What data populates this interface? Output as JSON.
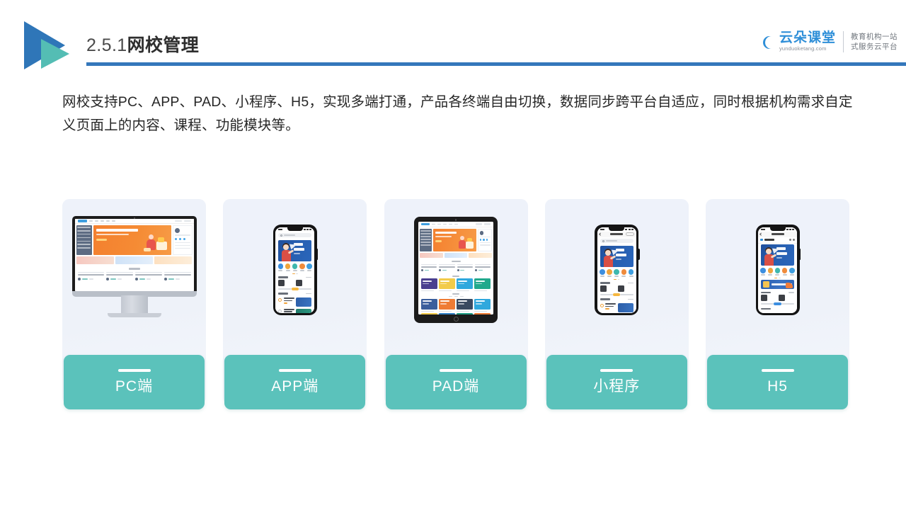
{
  "header": {
    "title_number": "2.5.1",
    "title_zh": "网校管理",
    "logo_icon": "double-triangle-logo",
    "rule_color": "#3477bb"
  },
  "brand": {
    "icon": "cloud-icon",
    "name_cn": "云朵课堂",
    "name_en": "yunduoketang.com",
    "tagline_line1": "教育机构一站",
    "tagline_line2": "式服务云平台",
    "color": "#2f8fd8"
  },
  "body": {
    "paragraph": "网校支持PC、APP、PAD、小程序、H5，实现多端打通，产品各终端自由切换，数据同步跨平台自适应，同时根据机构需求自定义页面上的内容、课程、功能模块等。"
  },
  "cards": [
    {
      "label": "PC端",
      "device": "imac-device",
      "accent": "#5bc2bb"
    },
    {
      "label": "APP端",
      "device": "iphone-device",
      "accent": "#5bc2bb"
    },
    {
      "label": "PAD端",
      "device": "ipad-device",
      "accent": "#5bc2bb"
    },
    {
      "label": "小程序",
      "device": "iphone-device",
      "accent": "#5bc2bb"
    },
    {
      "label": "H5",
      "device": "iphone-device",
      "accent": "#5bc2bb"
    }
  ],
  "colors": {
    "accent_teal": "#5bc2bb",
    "accent_blue": "#3477bb",
    "logo_blue": "#2f76b8",
    "logo_teal": "#54bdb4",
    "card_bg": "#eef2f9",
    "text_dark": "#262626"
  }
}
